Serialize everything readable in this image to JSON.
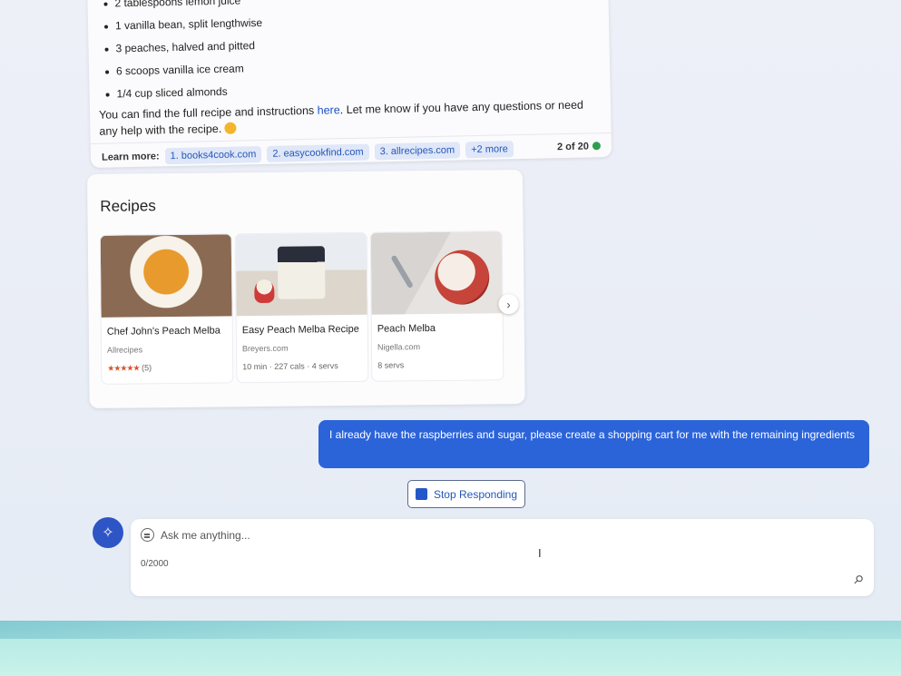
{
  "answer": {
    "ingredients": [
      "2 tablespoons lemon juice",
      "1 vanilla bean, split lengthwise",
      "3 peaches, halved and pitted",
      "6 scoops vanilla ice cream",
      "1/4 cup sliced almonds"
    ],
    "text_before": "You can find the full recipe and instructions ",
    "link_text": "here",
    "text_after": ". Let me know if you have any questions or need any help with the recipe.",
    "learn_more_label": "Learn more:",
    "sources": [
      "1. books4cook.com",
      "2. easycookfind.com",
      "3. allrecipes.com",
      "+2 more"
    ],
    "counter": "2 of 20"
  },
  "recipes": {
    "title": "Recipes",
    "items": [
      {
        "name": "Chef John's Peach Melba",
        "source": "Allrecipes",
        "stars": "★★★★★",
        "meta": "(5)"
      },
      {
        "name": "Easy Peach Melba Recipe",
        "source": "Breyers.com",
        "meta": "10 min · 227 cals · 4 servs"
      },
      {
        "name": "Peach Melba",
        "source": "Nigella.com",
        "meta": "8 servs"
      }
    ]
  },
  "user_message": "I already have the raspberries and sugar, please create a shopping cart for me with the remaining ingredients",
  "stop_button_label": "Stop Responding",
  "input": {
    "placeholder": "Ask me anything...",
    "char_count": "0/2000"
  },
  "colors": {
    "accent": "#2b63d9",
    "status_green": "#2f9e4f"
  }
}
